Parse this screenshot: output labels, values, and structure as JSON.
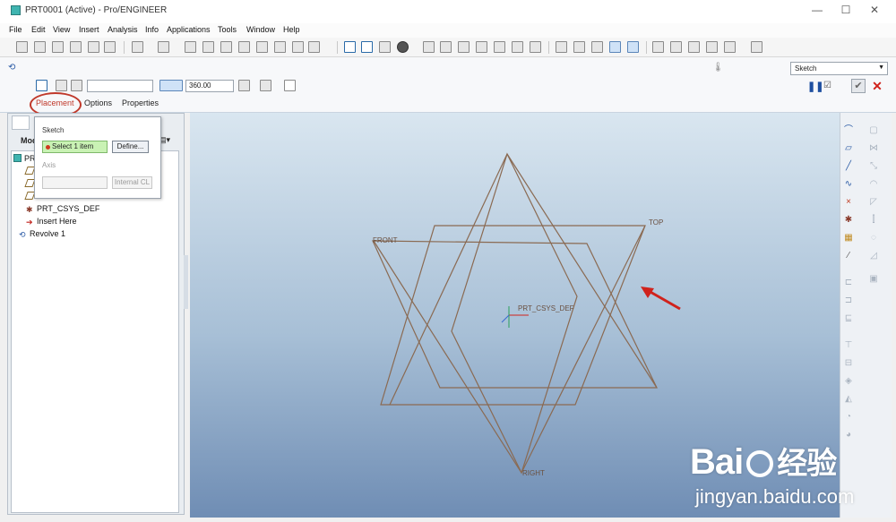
{
  "window": {
    "title": "PRT0001 (Active) - Pro/ENGINEER",
    "buttons": {
      "minimize": "—",
      "maximize": "☐",
      "close": "✕"
    }
  },
  "menubar": {
    "items": [
      "File",
      "Edit",
      "View",
      "Insert",
      "Analysis",
      "Info",
      "Applications",
      "Tools",
      "Window",
      "Help"
    ]
  },
  "dashboard": {
    "angle_value": "360.00",
    "tabs": [
      "Placement",
      "Options",
      "Properties"
    ],
    "sketch_mode": "Sketch"
  },
  "placement_panel": {
    "sketch_label": "Sketch",
    "collector_text": "Select 1 item",
    "define_button": "Define...",
    "axis_label": "Axis",
    "internal_button": "Internal CL"
  },
  "model_tree": {
    "header": "Mod",
    "items": [
      {
        "label": "PR",
        "icon": "part-icon"
      },
      {
        "label": "",
        "icon": "datum-plane-icon"
      },
      {
        "label": "",
        "icon": "datum-plane-icon"
      },
      {
        "label": "",
        "icon": "datum-plane-icon"
      },
      {
        "label": "PRT_CSYS_DEF",
        "icon": "csys-icon"
      },
      {
        "label": "Insert Here",
        "icon": "insert-arrow-icon"
      },
      {
        "label": "Revolve 1",
        "icon": "revolve-icon"
      }
    ]
  },
  "viewport": {
    "datum_labels": {
      "front": "FRONT",
      "top": "TOP",
      "right": "RIGHT",
      "csys": "PRT_CSYS_DEF"
    }
  },
  "watermark": {
    "brand": "Bai",
    "brand_suffix": "经验",
    "url": "jingyan.baidu.com"
  },
  "colors": {
    "datum_line": "#8a6a52",
    "annotation_red": "#d0221c",
    "collector_green": "#c9f2b4"
  }
}
